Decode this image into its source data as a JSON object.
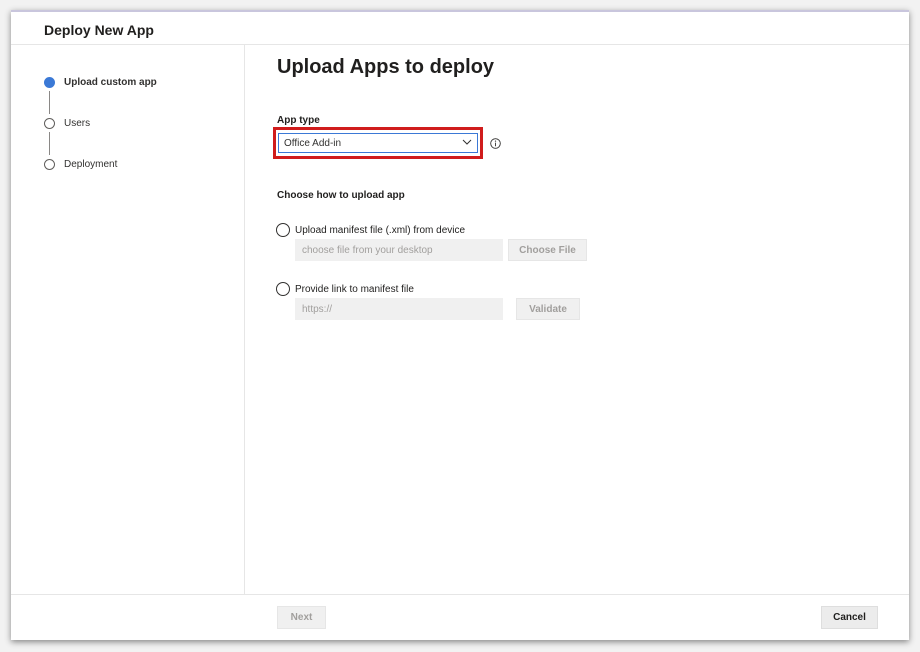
{
  "dialog": {
    "title": "Deploy New App"
  },
  "steps": [
    {
      "label": "Upload custom app",
      "active": true
    },
    {
      "label": "Users",
      "active": false
    },
    {
      "label": "Deployment",
      "active": false
    }
  ],
  "main": {
    "title": "Upload Apps to deploy",
    "app_type_label": "App type",
    "app_type_value": "Office Add-in",
    "upload_section_title": "Choose how to upload app",
    "option_file": {
      "label": "Upload manifest file (.xml) from device",
      "placeholder": "choose file from your desktop",
      "button": "Choose File"
    },
    "option_link": {
      "label": "Provide link to manifest file",
      "placeholder": "https://",
      "button": "Validate"
    }
  },
  "footer": {
    "next_label": "Next",
    "cancel_label": "Cancel"
  },
  "colors": {
    "accent": "#3b79d6",
    "highlight": "#d01c1c"
  }
}
